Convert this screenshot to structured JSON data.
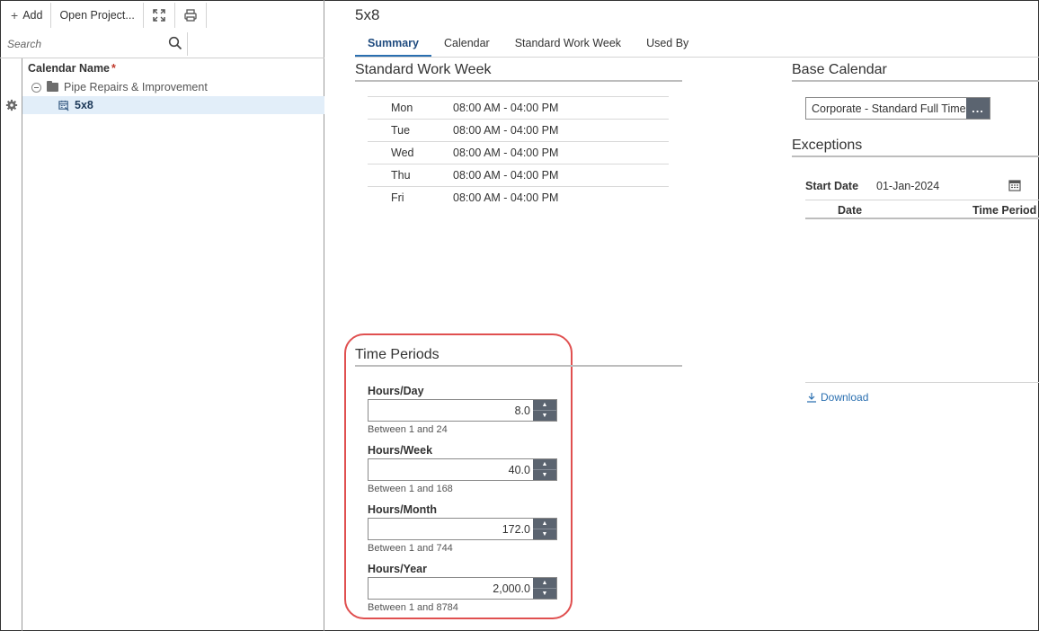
{
  "toolbar": {
    "add_label": "Add",
    "open_project_label": "Open Project...",
    "expand_icon": "expand-icon",
    "print_icon": "print-icon"
  },
  "search": {
    "placeholder": "Search"
  },
  "tree": {
    "column_header": "Calendar Name",
    "required_mark": "*",
    "folder_label": "Pipe Repairs & Improvement",
    "selected_label": "5x8"
  },
  "page": {
    "title": "5x8"
  },
  "tabs": [
    {
      "label": "Summary",
      "active": true
    },
    {
      "label": "Calendar",
      "active": false
    },
    {
      "label": "Standard Work Week",
      "active": false
    },
    {
      "label": "Used By",
      "active": false
    }
  ],
  "standard_work_week": {
    "title": "Standard Work Week",
    "rows": [
      {
        "day": "Mon",
        "time": "08:00 AM - 04:00 PM"
      },
      {
        "day": "Tue",
        "time": "08:00 AM - 04:00 PM"
      },
      {
        "day": "Wed",
        "time": "08:00 AM - 04:00 PM"
      },
      {
        "day": "Thu",
        "time": "08:00 AM - 04:00 PM"
      },
      {
        "day": "Fri",
        "time": "08:00 AM - 04:00 PM"
      }
    ]
  },
  "time_periods": {
    "title": "Time Periods",
    "fields": [
      {
        "label": "Hours/Day",
        "value": "8.0",
        "hint": "Between 1 and 24"
      },
      {
        "label": "Hours/Week",
        "value": "40.0",
        "hint": "Between 1 and 168"
      },
      {
        "label": "Hours/Month",
        "value": "172.0",
        "hint": "Between 1 and 744"
      },
      {
        "label": "Hours/Year",
        "value": "2,000.0",
        "hint": "Between 1 and 8784"
      }
    ]
  },
  "base_calendar": {
    "title": "Base Calendar",
    "value": "Corporate - Standard Full Time",
    "browse_label": "..."
  },
  "exceptions": {
    "title": "Exceptions",
    "start_date_label": "Start Date",
    "start_date_value": "01-Jan-2024",
    "col_date": "Date",
    "col_time_period": "Time Period",
    "download_label": "Download"
  },
  "colors": {
    "accent": "#2a6fb0",
    "highlight": "#e05050",
    "spinner": "#5b6470",
    "selected_row": "#e2eef9"
  }
}
